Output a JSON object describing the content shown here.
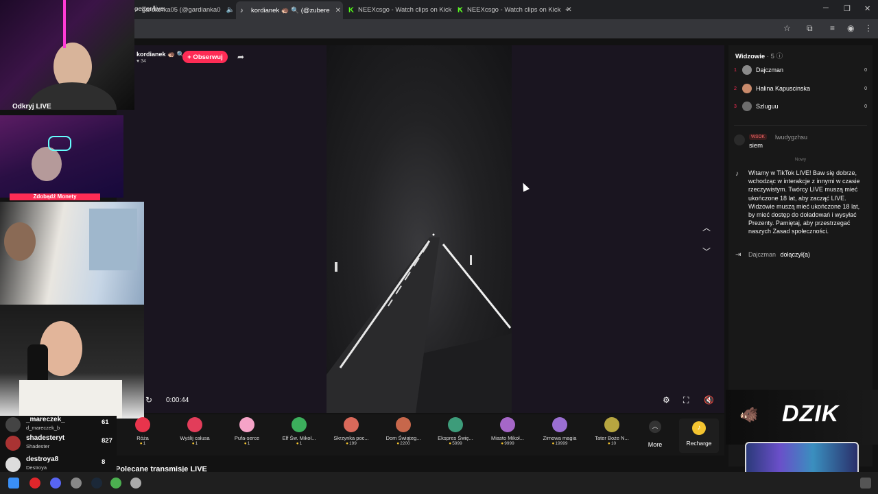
{
  "browser": {
    "tabs": [
      {
        "title": "gardianka05 (@gardianka0",
        "active": false
      },
      {
        "title": "kordianek 🦔 🔍 (@zubere",
        "active": true
      },
      {
        "title": "NEEXcsgo - Watch clips on Kick",
        "active": false
      },
      {
        "title": "NEEXcsgo - Watch clips on Kick",
        "active": false
      }
    ],
    "new_tab": "+",
    "url": "oetter/live"
  },
  "stream": {
    "host": "kordianek 🦔 🔍",
    "likes": "♥ 34",
    "follow_label": "+ Obserwuj",
    "elapsed": "0:00:44"
  },
  "gifts": [
    {
      "name": "Róża",
      "price": "1",
      "color": "#e8344c"
    },
    {
      "name": "Wyślij całusa",
      "price": "1",
      "color": "#e23d5a"
    },
    {
      "name": "Pufa-serce",
      "price": "1",
      "color": "#f5a3c7"
    },
    {
      "name": "Elf Św. Mikoł...",
      "price": "1",
      "color": "#3cae5c"
    },
    {
      "name": "Skrzynka poc...",
      "price": "199",
      "color": "#d9695a"
    },
    {
      "name": "Dom Świąteg...",
      "price": "2200",
      "color": "#c7674b"
    },
    {
      "name": "Ekspres Świę...",
      "price": "5999",
      "color": "#3d9c7a"
    },
    {
      "name": "Miasto Mikoł...",
      "price": "9999",
      "color": "#a567c7"
    },
    {
      "name": "Zimowa magia",
      "price": "19999",
      "color": "#9a6fd1"
    },
    {
      "name": "Tater Boże N...",
      "price": "10",
      "color": "#b7a640"
    }
  ],
  "more_label": "More",
  "recharge_label": "Recharge",
  "section_title": "Polecane transmisje LIVE",
  "viewers": {
    "title": "Widzowie",
    "count": "· 5",
    "list": [
      {
        "rank": "1",
        "name": "Dajczman",
        "score": "0"
      },
      {
        "rank": "2",
        "name": "Halina Kapuscinska",
        "score": "0"
      },
      {
        "rank": "3",
        "name": "Szluguu",
        "score": "0"
      }
    ]
  },
  "chat": {
    "badge": "WSOK",
    "user": "lwudygzhsu",
    "message": "siem",
    "new_divider": "Nowy",
    "system_message": "Witamy w TikTok LIVE! Baw się dobrze, wchodząc w interakcje z innymi w czasie rzeczywistym. Twórcy LIVE muszą mieć ukończone 18 lat, aby zacząć LIVE. Widzowie muszą mieć ukończone 18 lat, by mieć dostęp do doładowań i wysyłać Prezenty. Pamiętaj, aby przestrzegać naszych Zasad społeczności.",
    "join_user": "Dajczman",
    "join_text": "dołączył(a)"
  },
  "overlay": {
    "discover_live": "Odkryj LIVE",
    "get_coins": "Zdobądź Monety",
    "brand": "DZIK"
  },
  "followers": [
    {
      "name": "_mareczek_",
      "sub": "d_mareczek_b",
      "count": "61"
    },
    {
      "name": "shadesteryt",
      "sub": "Shadester",
      "count": "827"
    },
    {
      "name": "destroya8",
      "sub": "Destroya",
      "count": "8"
    }
  ]
}
